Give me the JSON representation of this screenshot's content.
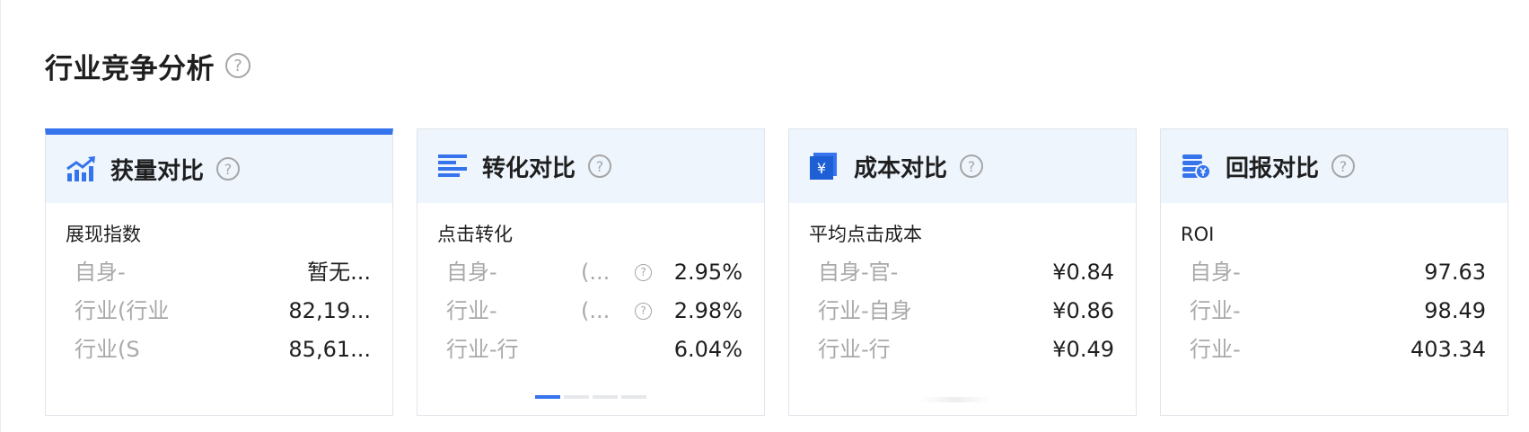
{
  "section": {
    "title": "行业竞争分析",
    "help": "?"
  },
  "colors": {
    "accent": "#3574ec",
    "card_header_bg": "#eef5fd",
    "muted_text": "#a9a9a9"
  },
  "cards": [
    {
      "title": "获量对比",
      "icon": "trend-chart-icon",
      "help": "?",
      "metric": "展现指数",
      "rows": [
        {
          "label": "自身-",
          "value": "暂无..."
        },
        {
          "label": "行业(行业",
          "value": "82,19..."
        },
        {
          "label": "行业(S",
          "value": "85,61..."
        }
      ]
    },
    {
      "title": "转化对比",
      "icon": "list-lines-icon",
      "help": "?",
      "metric": "点击转化",
      "rows": [
        {
          "label": "自身-",
          "extra": "(...",
          "help": "?",
          "value": "2.95%"
        },
        {
          "label": "行业-",
          "extra": "(...",
          "help": "?",
          "value": "2.98%"
        },
        {
          "label": "行业-行",
          "value": "6.04%"
        }
      ]
    },
    {
      "title": "成本对比",
      "icon": "yen-book-icon",
      "icon_text": "¥",
      "help": "?",
      "metric": "平均点击成本",
      "rows": [
        {
          "label": "自身-官-",
          "value": "¥0.84"
        },
        {
          "label": "行业-自身",
          "value": "¥0.86"
        },
        {
          "label": "行业-行",
          "value": "¥0.49"
        }
      ]
    },
    {
      "title": "回报对比",
      "icon": "coins-yen-icon",
      "help": "?",
      "metric": "ROI",
      "rows": [
        {
          "label": "自身-",
          "value": "97.63"
        },
        {
          "label": "行业-",
          "value": "98.49"
        },
        {
          "label": "行业-",
          "value": "403.34"
        }
      ]
    }
  ]
}
